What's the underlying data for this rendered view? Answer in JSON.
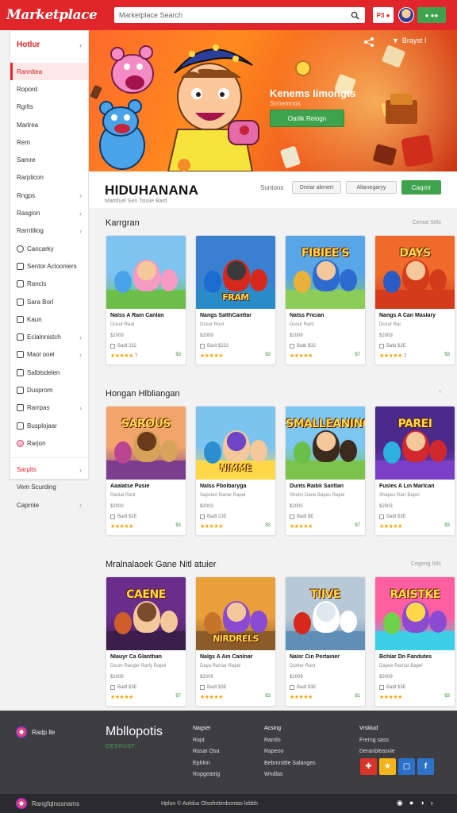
{
  "header": {
    "logo": "Marketplace",
    "search_placeholder": "Marketplace Search",
    "notif_label": "P3 ●",
    "cta_label": "● ●●"
  },
  "sidebar": {
    "title": "Hotlur",
    "items": [
      {
        "label": "Rannitea",
        "icon": "",
        "chevron": false,
        "active": true
      },
      {
        "label": "Ropord",
        "icon": "",
        "chevron": false
      },
      {
        "label": "Rgrlts",
        "icon": "",
        "chevron": false
      },
      {
        "label": "Marlrea",
        "icon": "",
        "chevron": false
      },
      {
        "label": "Rem",
        "icon": "",
        "chevron": false
      },
      {
        "label": "Samre",
        "icon": "",
        "chevron": false
      },
      {
        "label": "Rarplicon",
        "icon": "",
        "chevron": false
      },
      {
        "label": "Rngps",
        "icon": "",
        "chevron": true
      },
      {
        "label": "Rasgion",
        "icon": "",
        "chevron": true
      },
      {
        "label": "Rarntiliog",
        "icon": "",
        "chevron": true
      },
      {
        "label": "Cancarky",
        "icon": "circle",
        "chevron": false
      },
      {
        "label": "Sentor Aclooniers",
        "icon": "square",
        "chevron": false
      },
      {
        "label": "Rancis",
        "icon": "square",
        "chevron": false
      },
      {
        "label": "Sara Borl",
        "icon": "square",
        "chevron": false
      },
      {
        "label": "Kaun",
        "icon": "square",
        "chevron": false
      },
      {
        "label": "Eclalnnistch",
        "icon": "square",
        "chevron": true
      },
      {
        "label": "Maol ooel",
        "icon": "square",
        "chevron": true
      },
      {
        "label": "Salblsdelen",
        "icon": "square",
        "chevron": false
      },
      {
        "label": "Dusprom",
        "icon": "square",
        "chevron": false
      },
      {
        "label": "Rarrpas",
        "icon": "square",
        "chevron": true
      },
      {
        "label": "Busplojaar",
        "icon": "square",
        "chevron": false
      },
      {
        "label": "Rarjon",
        "icon": "pink",
        "chevron": false
      }
    ],
    "footer_items": [
      {
        "label": "Sarplts",
        "chevron": true,
        "red": true
      },
      {
        "label": "Vem Scurding",
        "chevron": false
      },
      {
        "label": "Caprnie",
        "chevron": true
      }
    ]
  },
  "hero": {
    "title": "Kenems Iimongts",
    "subtitle": "Srmemnos",
    "button": "Oarlik Reiogn",
    "brand": "Brayst I"
  },
  "main": {
    "title": "HIDUHANANA",
    "subtitle": "Martifuel Sen Tsisiie Bartl",
    "sort_label": "Suntons",
    "pill1": "Dreiar alenert",
    "pill2": "Altanegaryy",
    "button": "Caqrnr"
  },
  "sections": [
    {
      "title": "Karrgran",
      "links": "Cenoe   Sttlc",
      "cards": [
        {
          "title": "Nalss A Rain Canlan",
          "meta": "Dusur Raat",
          "price": "$2009",
          "count_line": "Badt  232",
          "rating": "★★★★★",
          "rating_n": "7",
          "count": "$3",
          "art": "a"
        },
        {
          "title": "Nangs SalthCanttar",
          "meta": "Dosor Rout",
          "price": "$2009",
          "count_line": "Barit  $232",
          "rating": "★★★★★",
          "rating_n": "",
          "count": "$3",
          "art": "b",
          "word": "FRAM"
        },
        {
          "title": "Natss Fncian",
          "meta": "Dusur Rant",
          "price": "$2009",
          "count_line": "Batb  $32",
          "rating": "★★★★★",
          "rating_n": "",
          "count": "$7",
          "art": "c",
          "word": "FIBIEE'S"
        },
        {
          "title": "Nangs A Can Maslary",
          "meta": "Dusur Rar",
          "price": "$2009",
          "count_line": "Batb  $2E",
          "rating": "★★★★★",
          "rating_n": "7",
          "count": "$3",
          "art": "d",
          "word": "DAYS"
        }
      ]
    },
    {
      "title": "Hongan Hlbliangan",
      "links": "^",
      "cards": [
        {
          "title": "Aaalatse Pusie",
          "meta": "Ranlat Rant",
          "price": "$2003",
          "count_line": "Badt  $2E",
          "rating": "★★★★★",
          "rating_n": "",
          "count": "$3",
          "art": "e",
          "word": "SAROUS"
        },
        {
          "title": "Nalss Fbolbaryga",
          "meta": "Sapslert  Raner  Rapel",
          "price": "$2003",
          "count_line": "Badt  2JE",
          "rating": "★★★★★",
          "rating_n": "",
          "count": "$3",
          "art": "f",
          "word": "NIMME"
        },
        {
          "title": "Dunts Raibli Santlan",
          "meta": "Shetrs Dane  Bapes Rapel",
          "price": "$2003",
          "count_line": "Badt  $E",
          "rating": "★★★★★",
          "rating_n": "",
          "count": "$7",
          "art": "g",
          "word": "SMALLEANING"
        },
        {
          "title": "Fusles A Lin Marlcan",
          "meta": "Shapes Rarr  Bapel",
          "price": "$2003",
          "count_line": "Badt  $3E",
          "rating": "★★★★★",
          "rating_n": "",
          "count": "$3",
          "art": "h",
          "word": "PAREI"
        }
      ]
    },
    {
      "title": "Mralnalaoek Gane Nitl atuier",
      "links": "Cegeng   Stlc",
      "cards": [
        {
          "title": "Nlauyr Ca Glanthan",
          "meta": "Dsum Ranger Rarfy Rapel",
          "price": "$2009",
          "count_line": "Badt  $3E",
          "rating": "★★★★★",
          "rating_n": "",
          "count": "$7",
          "art": "i",
          "word": "CAENE"
        },
        {
          "title": "Nalgs A Ain Canlnar",
          "meta": "Daya Rarnar Rapel",
          "price": "$2009",
          "count_line": "Badt  $3E",
          "rating": "★★★★★",
          "rating_n": "",
          "count": "$3",
          "art": "j",
          "word": "NIRDRELS"
        },
        {
          "title": "Nalsr Cin Pertainer",
          "meta": "Dunter Rant",
          "price": "$2009",
          "count_line": "Badt  $3E",
          "rating": "★★★★★",
          "rating_n": "",
          "count": "$1",
          "art": "k",
          "word": "TIIVE"
        },
        {
          "title": "Bchlar Dn Fandutes",
          "meta": "Dapee Rarnar Bapel",
          "price": "$2009",
          "count_line": "Badt  $3E",
          "rating": "★★★★★",
          "rating_n": "",
          "count": "$3",
          "art": "l",
          "word": "RAISTKE"
        }
      ]
    }
  ],
  "footer": {
    "brand_label": "Radp lle",
    "name": "Mbllopotis",
    "tag": "OESRUST",
    "col1": [
      "Nagser",
      "Rapt",
      "Rasar Osa",
      "Ephlrin",
      "Ropgeatrig"
    ],
    "col2": [
      "Acsing",
      "Rarnlo",
      "Rapeoo",
      "Bebrnnittle Salanges",
      "Wndlas"
    ],
    "col3": [
      "Vrsklud",
      "Frerng sass",
      "Deranbleasvie"
    ],
    "social": [
      "✚",
      "★",
      "▢",
      "f"
    ]
  },
  "bottombar": {
    "brand": "Rangfqlnosnams",
    "center": "Hplun ©  Aoldus  Olsofnttimbontas lebbh",
    "icons": [
      "◉",
      "●",
      "◑",
      "›"
    ]
  },
  "colors": {
    "accent": "#e0262b",
    "green": "#3fa34d",
    "footer": "#3e3e42"
  }
}
